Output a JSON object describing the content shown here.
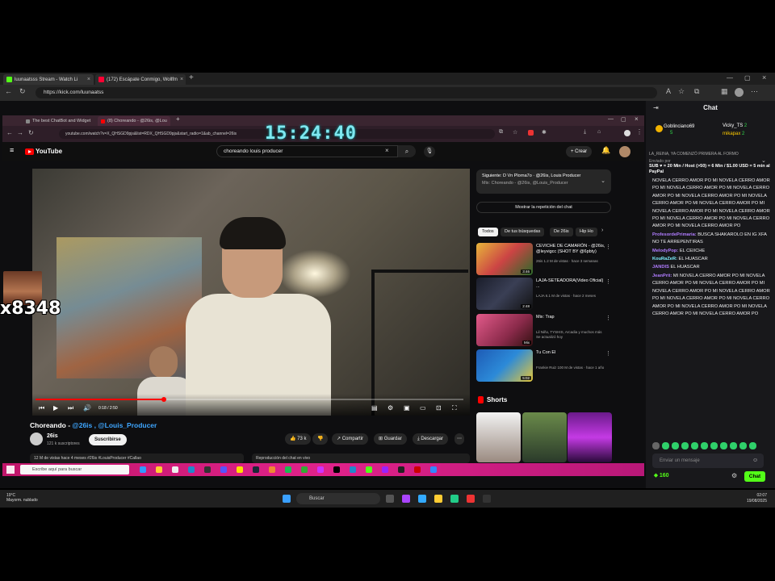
{
  "outer_browser": {
    "tabs": [
      {
        "label": "luunaatsss Stream - Watch Li",
        "color": "#53fc18"
      },
      {
        "label": "(172) Escápate Conmigo, Wollfm",
        "color": "#ff0033"
      }
    ],
    "url": "https://kick.com/luunaatss"
  },
  "inner_browser": {
    "tabs": [
      {
        "label": "The best ChatBot and Widget"
      },
      {
        "label": "(8) Choreando - @26is, @Lou"
      }
    ],
    "url": "youtube.com/watch?v=X_QHSGD9pjs&list=RDX_QHSGD9pjs&start_radio=1&ab_channel=26is"
  },
  "overlay_clock": "15:24:40",
  "youtube": {
    "logo": "YouTube",
    "search_value": "choreando louis producer",
    "create_label": "+ Crear",
    "video": {
      "time": "0:18 / 2:50",
      "progress": 0.3,
      "title_prefix": "Choreando - ",
      "title_tags": "@26is , @Louis_Producer",
      "channel": "26is",
      "subs": "121 k suscriptores",
      "subscribe": "Suscribirse",
      "likes": "73 k",
      "share": "Compartir",
      "save": "Guardar",
      "download": "Descargar",
      "desc": "12 M de vistas  hace 4 meses  #26is #LouisProducer #Callao",
      "chat_replay": "Reproducción del chat en vivo"
    },
    "next": {
      "title": "Siguiente: D Vn Plorna7o · @26is, Louis Producer",
      "sub": "Mix: Choreando - @26is, @Louis_Producer"
    },
    "show_chat": "Mostrar la repetición del chat",
    "chips": [
      "Todos",
      "De tus búsquedas",
      "De 26is",
      "Hip Ho"
    ],
    "recs": [
      {
        "title": "CEVICHE DE CAMARÓN - @26is, @leyvigcc (SHOT BY @6pbty)",
        "meta": "26is\n1.2 M de vistas · hace 3 semanas",
        "dur": "3:46"
      },
      {
        "title": "LAJA-SETEADORA(Video Oficial) ...",
        "meta": "LAJA\n6.1 M de vistas · hace 2 meses",
        "dur": "2:48"
      },
      {
        "title": "Mix: Trap",
        "meta": "Lil Niño, TYSHIS, Arcadia y muchos más\nSe actualizó hoy",
        "dur": "Mix"
      },
      {
        "title": "Tu Con El",
        "meta": "Frankie Ruiz\n100 M de vistas · hace 1 año",
        "dur": "5:02"
      }
    ],
    "shorts_label": "Shorts"
  },
  "overlay_cam_text": "x8348",
  "inner_taskbar": {
    "search": "Escribe aquí para buscar"
  },
  "chat": {
    "title": "Chat",
    "gifters": [
      {
        "name": "Goblinciano69",
        "count": "5"
      },
      {
        "name": "Vicky_TS",
        "count": "2"
      },
      {
        "name": "mikapax",
        "count": "2"
      }
    ],
    "pinned_by": "Enviado por",
    "pinned_top": "LA_REINA, YA COMENZÓ PRIMERA AL FORMO",
    "pinned": "SUB ♥ = 20 Min / Host (>50) = 6 Min / $1.00 USD = 5 min al PayPal",
    "messages": [
      {
        "user": "",
        "text": "NOVELA CERRO AMOR PO MI NOVELA CERRO AMOR PO MI NOVELA CERRO AMOR PO MI NOVELA CERRO AMOR PO MI NOVELA CERRO AMOR PO MI NOVELA CERRO AMOR PO MI NOVELA CERRO AMOR PO MI NOVELA CERRO AMOR PO MI NOVELA CERRO AMOR PO MI NOVELA CERRO AMOR PO MI NOVELA CERRO AMOR PO MI NOVELA CERRO AMOR PO",
        "color": "#efeff1"
      },
      {
        "user": "ProfesordePrimaria:",
        "text": " BUSCA SHAKAROLO EN IG XFA NO TE ARREPENTIRAS",
        "color": "#b07cff"
      },
      {
        "user": "MelodyPop:",
        "text": " EL CEIICHE",
        "color": "#b07cff"
      },
      {
        "user": "KouRaZeR:",
        "text": " EL HUASCAR",
        "color": "#7cf0ff"
      },
      {
        "user": "JANDIS",
        "text": " EL HUASCAR",
        "color": "#b07cff"
      },
      {
        "user": "JeanPrit:",
        "text": " MI NOVELA CERRO AMOR PO MI NOVELA CERRO AMOR PO MI NOVELA CERRO AMOR PO MI NOVELA CERRO AMOR PO MI NOVELA CERRO AMOR PO MI NOVELA CERRO AMOR PO MI NOVELA CERRO AMOR PO MI NOVELA CERRO AMOR PO MI NOVELA CERRO AMOR PO MI NOVELA CERRO AMOR PO",
        "color": "#b07cff"
      }
    ],
    "input_placeholder": "Enviar un mensaje",
    "points": "160",
    "send": "Chat"
  },
  "taskbar": {
    "search": "Buscar",
    "weather_temp": "19°C",
    "weather_desc": "Mayorm. nublado",
    "time": "02:07",
    "date": "19/08/2025"
  }
}
